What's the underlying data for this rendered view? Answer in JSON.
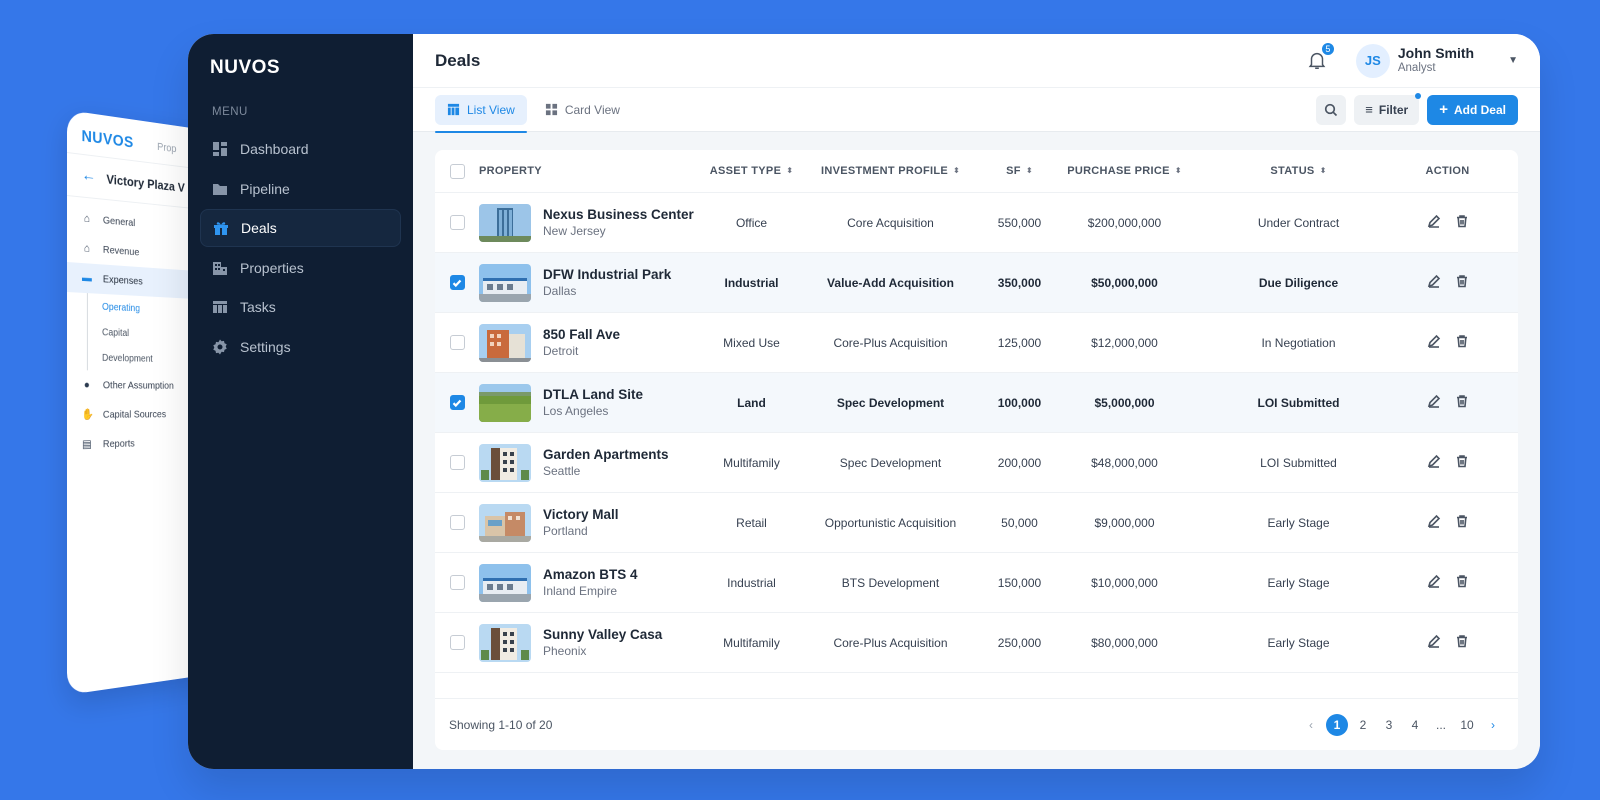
{
  "colors": {
    "background": "#3577e9",
    "sidebar": "#0f1e33",
    "accent": "#1e88e5"
  },
  "back_panel": {
    "logo": "NUVOS",
    "crumb": "Prop",
    "title": "Victory Plaza V",
    "items": [
      {
        "label": "General",
        "icon": "home-icon"
      },
      {
        "label": "Revenue",
        "icon": "home-icon"
      },
      {
        "label": "Expenses",
        "icon": "card-icon",
        "active": true
      }
    ],
    "sub_items": [
      {
        "label": "Operating",
        "active": true
      },
      {
        "label": "Capital"
      },
      {
        "label": "Development"
      }
    ],
    "items2": [
      {
        "label": "Other Assumption",
        "icon": "bulb-icon"
      },
      {
        "label": "Capital Sources",
        "icon": "hand-coin-icon"
      },
      {
        "label": "Reports",
        "icon": "document-icon"
      }
    ]
  },
  "sidebar": {
    "logo": "NUVOS",
    "menu_label": "MENU",
    "items": [
      {
        "label": "Dashboard",
        "icon": "dashboard-icon"
      },
      {
        "label": "Pipeline",
        "icon": "folder-icon"
      },
      {
        "label": "Deals",
        "icon": "gift-icon",
        "active": true
      },
      {
        "label": "Properties",
        "icon": "building-icon"
      },
      {
        "label": "Tasks",
        "icon": "table-icon"
      },
      {
        "label": "Settings",
        "icon": "gear-icon"
      }
    ]
  },
  "header": {
    "title": "Deals",
    "notifications": "5",
    "user": {
      "initials": "JS",
      "name": "John Smith",
      "role": "Analyst"
    }
  },
  "toolbar": {
    "tabs": [
      {
        "label": "List View",
        "active": true
      },
      {
        "label": "Card View"
      }
    ],
    "filter_label": "Filter",
    "add_label": "Add Deal"
  },
  "table": {
    "columns": {
      "property": "PROPERTY",
      "asset_type": "ASSET TYPE",
      "investment_profile": "INVESTMENT PROFILE",
      "sf": "SF",
      "purchase_price": "PURCHASE PRICE",
      "status": "STATUS",
      "action": "ACTION"
    },
    "rows": [
      {
        "name": "Nexus Business Center",
        "city": "New Jersey",
        "asset_type": "Office",
        "profile": "Core Acquisition",
        "sf": "550,000",
        "price": "$200,000,000",
        "status": "Under Contract",
        "selected": false,
        "thumb": "tower"
      },
      {
        "name": "DFW Industrial Park",
        "city": "Dallas",
        "asset_type": "Industrial",
        "profile": "Value-Add Acquisition",
        "sf": "350,000",
        "price": "$50,000,000",
        "status": "Due Diligence",
        "selected": true,
        "thumb": "industrial"
      },
      {
        "name": "850 Fall Ave",
        "city": "Detroit",
        "asset_type": "Mixed Use",
        "profile": "Core-Plus Acquisition",
        "sf": "125,000",
        "price": "$12,000,000",
        "status": "In Negotiation",
        "selected": false,
        "thumb": "mixed"
      },
      {
        "name": "DTLA Land Site",
        "city": "Los Angeles",
        "asset_type": "Land",
        "profile": "Spec Development",
        "sf": "100,000",
        "price": "$5,000,000",
        "status": "LOI Submitted",
        "selected": true,
        "thumb": "land"
      },
      {
        "name": "Garden Apartments",
        "city": "Seattle",
        "asset_type": "Multifamily",
        "profile": "Spec Development",
        "sf": "200,000",
        "price": "$48,000,000",
        "status": "LOI Submitted",
        "selected": false,
        "thumb": "apartment"
      },
      {
        "name": "Victory Mall",
        "city": "Portland",
        "asset_type": "Retail",
        "profile": "Opportunistic Acquisition",
        "sf": "50,000",
        "price": "$9,000,000",
        "status": "Early Stage",
        "selected": false,
        "thumb": "mall"
      },
      {
        "name": "Amazon BTS 4",
        "city": "Inland Empire",
        "asset_type": "Industrial",
        "profile": "BTS Development",
        "sf": "150,000",
        "price": "$10,000,000",
        "status": "Early Stage",
        "selected": false,
        "thumb": "industrial"
      },
      {
        "name": "Sunny Valley Casa",
        "city": "Pheonix",
        "asset_type": "Multifamily",
        "profile": "Core-Plus Acquisition",
        "sf": "250,000",
        "price": "$80,000,000",
        "status": "Early Stage",
        "selected": false,
        "thumb": "apartment"
      }
    ],
    "footer": "Showing 1-10 of 20",
    "pages": [
      "1",
      "2",
      "3",
      "4",
      "...",
      "10"
    ],
    "current_page": "1"
  }
}
